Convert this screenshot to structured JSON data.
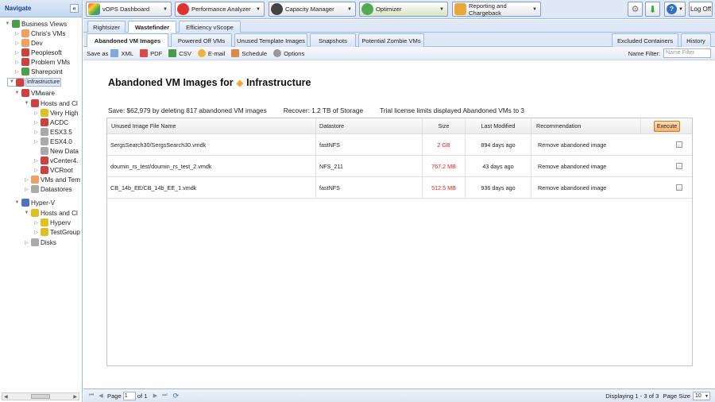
{
  "nav": {
    "title": "Navigate",
    "collapse": "«",
    "tree": [
      {
        "label": "Business Views",
        "color": "#4aa04a"
      },
      {
        "label": "Chris's VMs",
        "color": "#f0a060"
      },
      {
        "label": "Dev",
        "color": "#f0a060"
      },
      {
        "label": "Peoplesoft",
        "color": "#d04040"
      },
      {
        "label": "Problem VMs",
        "color": "#d04040"
      },
      {
        "label": "Sharepoint",
        "color": "#4aa04a"
      },
      {
        "label": "Infrastructure",
        "color": "#d04040"
      },
      {
        "label": "VMware",
        "color": "#d04040"
      },
      {
        "label": "Hosts and Cl",
        "color": "#d04040"
      },
      {
        "label": "Very High",
        "color": "#e0c020"
      },
      {
        "label": "ACDC",
        "color": "#d04040"
      },
      {
        "label": "ESX3.5",
        "color": "#aaaaaa"
      },
      {
        "label": "ESX4.0",
        "color": "#aaaaaa"
      },
      {
        "label": "New Data",
        "color": "#aaaaaa"
      },
      {
        "label": "vCenter4.",
        "color": "#d04040"
      },
      {
        "label": "VCRoot",
        "color": "#d04040"
      },
      {
        "label": "VMs and Tem",
        "color": "#f0a060"
      },
      {
        "label": "Datastores",
        "color": "#aaaaaa"
      },
      {
        "label": "Hyper-V",
        "color": "#5070c0"
      },
      {
        "label": "Hosts and Cl",
        "color": "#e0c020"
      },
      {
        "label": "Hyperv",
        "color": "#e0c020"
      },
      {
        "label": "TestGroup",
        "color": "#e0c020"
      },
      {
        "label": "Disks",
        "color": "#aaaaaa"
      }
    ]
  },
  "topbar": {
    "dashboard": "vOPS Dashboard",
    "performance": "Performance Analyzer",
    "capacity": "Capacity Manager",
    "optimizer": "Optimizer",
    "reporting": "Reporting and Chargeback",
    "logoff": "Log Off"
  },
  "tabs1": [
    "Rightsizer",
    "Wastefinder",
    "Efficiency vScope"
  ],
  "tabs2": [
    "Abandoned VM Images",
    "Powered Off VMs",
    "Unused Template Images",
    "Snapshots",
    "Potential Zombie VMs"
  ],
  "tabs2_right": [
    "Excluded Containers",
    "History"
  ],
  "toolbar": {
    "save_as": "Save as",
    "xml": "XML",
    "pdf": "PDF",
    "csv": "CSV",
    "email": "E-mail",
    "schedule": "Schedule",
    "options": "Options",
    "filter_label": "Name Filter:",
    "filter_placeholder": "Name Filter"
  },
  "report": {
    "title_prefix": "Abandoned VM Images for",
    "title_entity": "Infrastructure",
    "save": "Save: $62,979 by deleting 817 abandoned VM images",
    "recover": "Recover: 1.2 TB of Storage",
    "license": "Trial license limits displayed Abandoned VMs to 3"
  },
  "grid": {
    "headers": [
      "Unused Image File Name",
      "Datastore",
      "Size",
      "Last Modified",
      "Recommendation"
    ],
    "execute": "Execute",
    "rows": [
      {
        "file": "SergsSearch30/SergsSearch30.vmdk",
        "datastore": "fastNFS",
        "size": "2 GB",
        "modified": "894 days ago",
        "rec": "Remove abandoned image"
      },
      {
        "file": "doumin_rs_test/doumin_rs_test_2.vmdk",
        "datastore": "NFS_211",
        "size": "767.2 MB",
        "modified": "43 days ago",
        "rec": "Remove abandoned image"
      },
      {
        "file": "CB_14b_EE/CB_14b_EE_1.vmdk",
        "datastore": "fastNFS",
        "size": "512.5 MB",
        "modified": "936 days ago",
        "rec": "Remove abandoned image"
      }
    ]
  },
  "pager": {
    "page_label": "Page",
    "page_value": "1",
    "of_label": "of 1",
    "displaying": "Displaying 1 - 3 of 3",
    "page_size_label": "Page Size",
    "page_size": "10"
  }
}
